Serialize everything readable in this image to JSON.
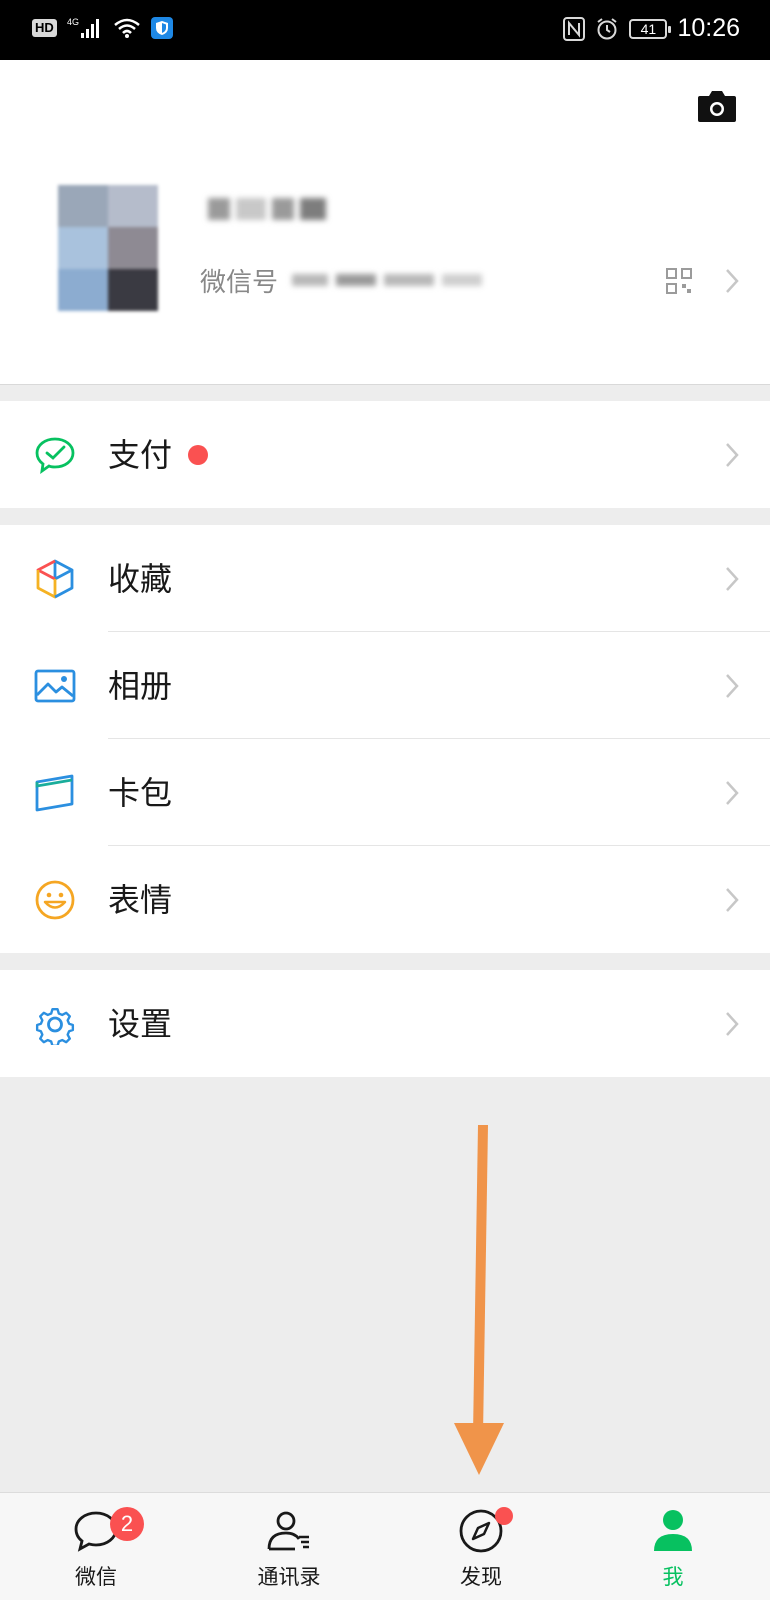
{
  "status_bar": {
    "hd": "HD",
    "network": "4G",
    "battery": "41",
    "time": "10:26"
  },
  "profile": {
    "wechat_id_label": "微信号"
  },
  "menu": {
    "pay": {
      "label": "支付",
      "icon": "wechat-pay-icon",
      "has_red_dot": true
    },
    "favorites": {
      "label": "收藏",
      "icon": "favorites-cube-icon"
    },
    "moments": {
      "label": "相册",
      "icon": "album-icon"
    },
    "cards": {
      "label": "卡包",
      "icon": "card-wallet-icon"
    },
    "stickers": {
      "label": "表情",
      "icon": "sticker-smiley-icon"
    },
    "settings": {
      "label": "设置",
      "icon": "gear-icon"
    }
  },
  "tabbar": {
    "chats": {
      "label": "微信",
      "badge": "2",
      "icon": "chat-bubble-icon"
    },
    "contacts": {
      "label": "通讯录",
      "icon": "contacts-icon"
    },
    "discover": {
      "label": "发现",
      "icon": "compass-icon",
      "has_dot": true
    },
    "me": {
      "label": "我",
      "icon": "person-icon",
      "active": true
    }
  },
  "colors": {
    "accent_green": "#07c160",
    "badge_red": "#fa5151",
    "annotation_arrow": "#f0944a",
    "page_bg": "#ededed"
  }
}
